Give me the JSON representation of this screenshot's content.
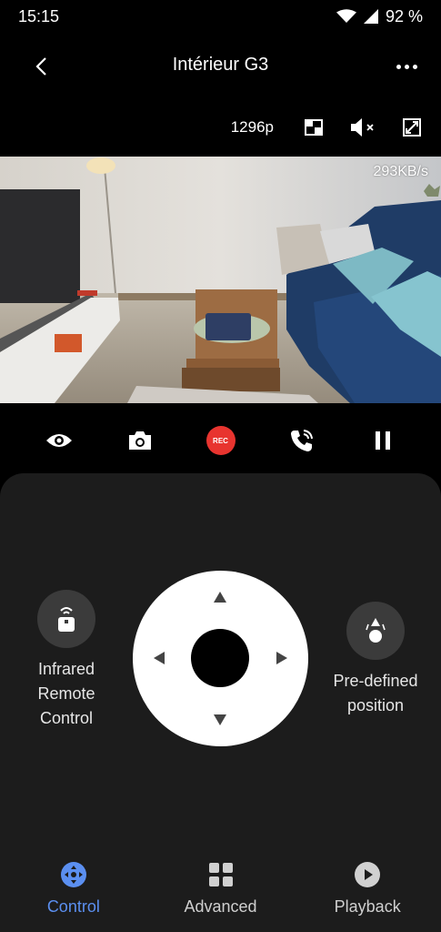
{
  "status_bar": {
    "time": "15:15",
    "battery": "92 %"
  },
  "header": {
    "title": "Intérieur G3",
    "back_icon": "chevron-left-icon",
    "more_icon": "more-horizontal-icon"
  },
  "video_toolbar": {
    "resolution": "1296p"
  },
  "video": {
    "bitrate": "293KB/s"
  },
  "actions": [
    {
      "name": "eye-icon"
    },
    {
      "name": "camera-icon"
    },
    {
      "name": "record-button",
      "label": "REC"
    },
    {
      "name": "phone-call-icon"
    },
    {
      "name": "pause-icon"
    }
  ],
  "controls": {
    "infrared": {
      "label": "Infrared Remote Control"
    },
    "preset": {
      "label": "Pre-defined position"
    }
  },
  "nav": {
    "control": "Control",
    "advanced": "Advanced",
    "playback": "Playback"
  },
  "colors": {
    "accent": "#5b8ff0",
    "record": "#e8342f",
    "panel": "#1c1c1c"
  }
}
